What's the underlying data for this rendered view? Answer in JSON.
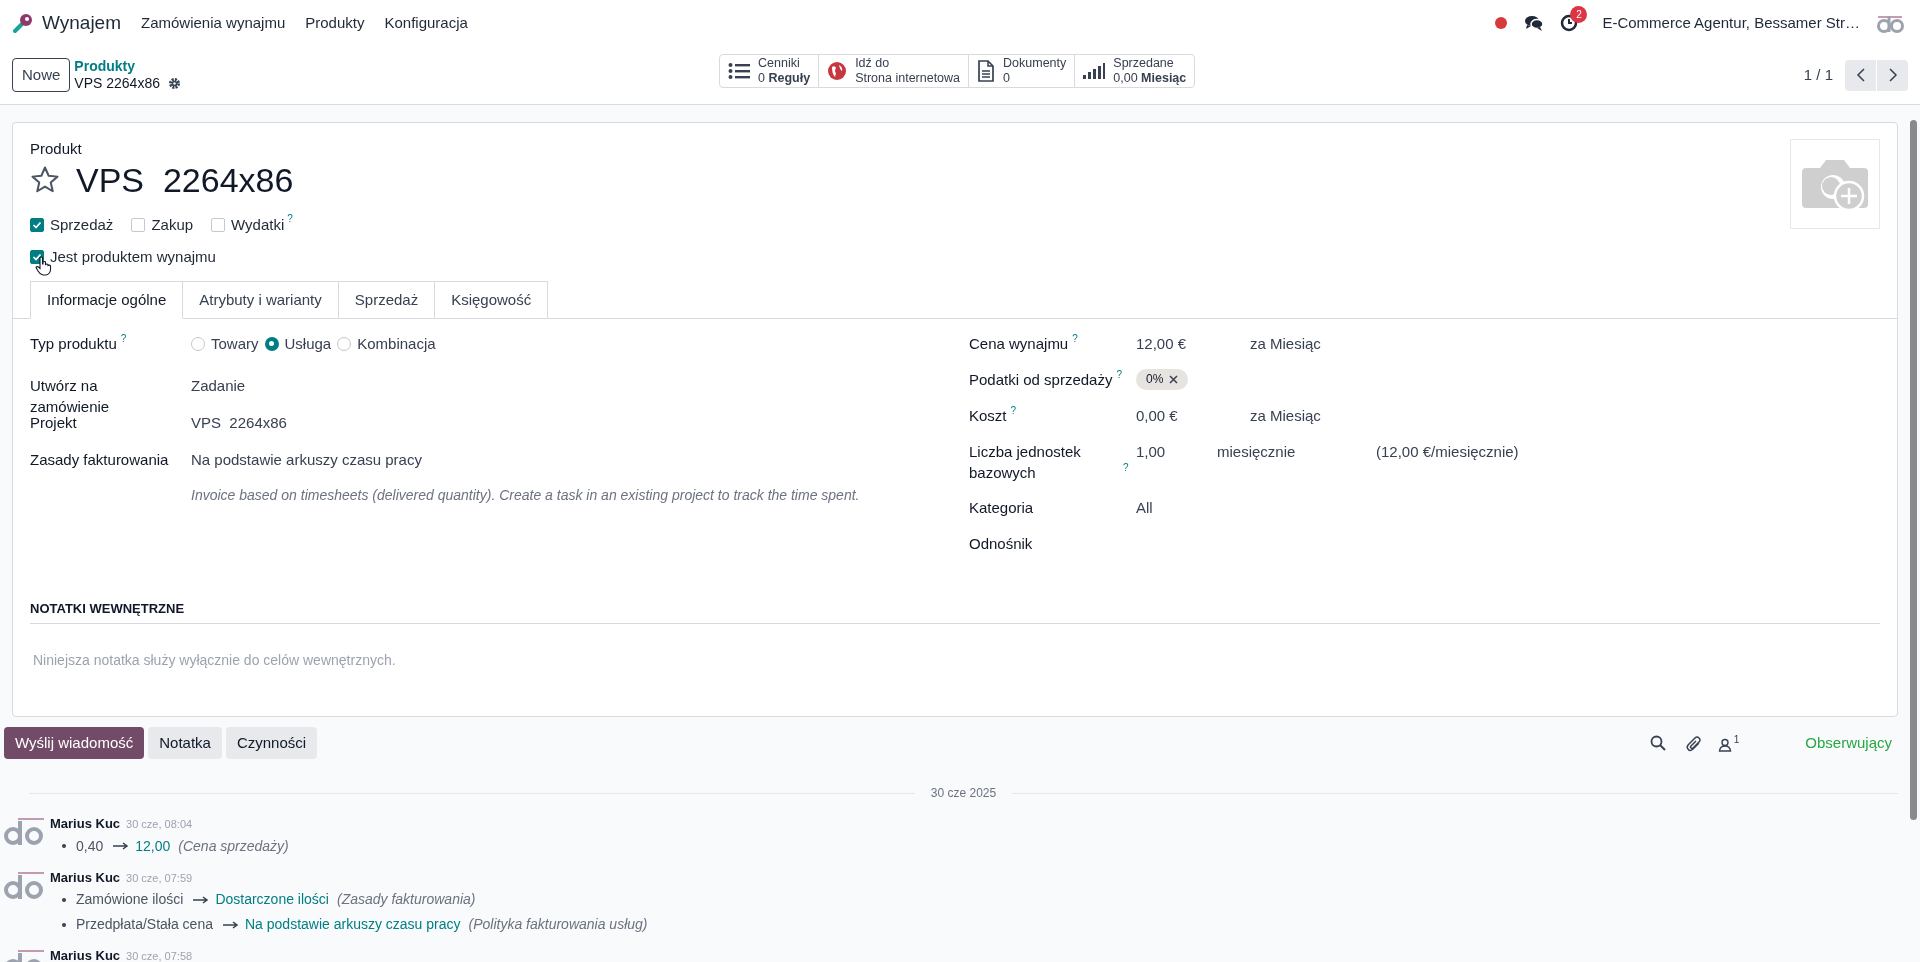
{
  "navbar": {
    "app_name": "Wynajem",
    "menu": [
      "Zamówienia wynajmu",
      "Produkty",
      "Konfiguracja"
    ],
    "activity_badge": "2",
    "company": "E-Commerce Agentur, Bessamer Str…"
  },
  "control_panel": {
    "new_button": "Nowe",
    "breadcrumb": "Produkty",
    "record_name": "VPS 2264x86",
    "smart_buttons": [
      {
        "kind": "list",
        "label": "Cenniki",
        "value": "0",
        "unit": "Reguły"
      },
      {
        "kind": "globe",
        "label": "Idź do",
        "value": "Strona internetowa"
      },
      {
        "kind": "document",
        "label": "Dokumenty",
        "value": "0"
      },
      {
        "kind": "bars",
        "label": "Sprzedane",
        "value": "0,00",
        "unit": "Miesiąc"
      }
    ],
    "pager": "1 / 1"
  },
  "form": {
    "caption": "Produkt",
    "name": "VPS  2264x86",
    "favorite": false,
    "options": [
      {
        "label": "Sprzedaż",
        "checked": true
      },
      {
        "label": "Zakup",
        "checked": false
      },
      {
        "label": "Wydatki",
        "checked": false,
        "help": "?"
      }
    ],
    "rental": {
      "label": "Jest produktem wynajmu",
      "checked": true
    },
    "tabs": [
      {
        "label": "Informacje ogólne",
        "selected": true
      },
      {
        "label": "Atrybuty i warianty",
        "selected": false
      },
      {
        "label": "Sprzedaż",
        "selected": false
      },
      {
        "label": "Księgowość",
        "selected": false
      }
    ],
    "left_fields": [
      {
        "kind": "radio",
        "label": "Typ produktu",
        "help": "?",
        "options": [
          {
            "label": "Towary",
            "selected": false
          },
          {
            "label": "Usługa",
            "selected": true
          },
          {
            "label": "Kombinacja",
            "selected": false
          }
        ]
      },
      {
        "kind": "text",
        "label": "Utwórz na zamówienie",
        "value": "Zadanie"
      },
      {
        "kind": "text",
        "label": "Projekt",
        "value": "VPS  2264x86"
      },
      {
        "kind": "text",
        "label": "Zasady fakturowania",
        "value": "Na podstawie arkuszy czasu pracy",
        "note": "Invoice based on timesheets (delivered quantity). Create a task in an existing project to track the time spent."
      }
    ],
    "right_fields": [
      {
        "kind": "text",
        "label": "Cena wynajmu",
        "help": "?",
        "value": "12,00 €",
        "suffix": "za Miesiąc"
      },
      {
        "kind": "tags",
        "label": "Podatki od sprzedaży",
        "help": "?",
        "tags": [
          "0%"
        ]
      },
      {
        "kind": "text",
        "label": "Koszt",
        "help": "?",
        "value": "0,00 €",
        "suffix": "za Miesiąc"
      },
      {
        "kind": "units",
        "label": "Liczba jednostek bazowych",
        "help": "?",
        "value": "1,00",
        "unit": "miesięcznie",
        "note": "(12,00 €/miesięcznie)"
      },
      {
        "kind": "text",
        "label": "Kategoria",
        "value": "All"
      },
      {
        "kind": "text",
        "label": "Odnośnik"
      }
    ],
    "notes": {
      "title": "NOTATKI WEWNĘTRZNE",
      "placeholder": "Niniejsza notatka służy wyłącznie do celów wewnętrznych."
    }
  },
  "chatter": {
    "buttons": [
      {
        "label": "Wyślij wiadomość",
        "selected": true
      },
      {
        "label": "Notatka",
        "selected": false
      },
      {
        "label": "Czynności",
        "selected": false
      }
    ],
    "followers_count": "1",
    "follow": "Obserwujący",
    "date": "30 cze 2025",
    "messages": [
      {
        "author": "Marius Kuc",
        "time": "30 cze, 08:04",
        "changes": [
          {
            "old": "0,40",
            "new": "12,00",
            "field": "(Cena sprzedaży)"
          }
        ]
      },
      {
        "author": "Marius Kuc",
        "time": "30 cze, 07:59",
        "changes": [
          {
            "old": "Zamówione ilości",
            "new": "Dostarczone ilości",
            "field": "(Zasady fakturowania)"
          },
          {
            "old": "Przedpłata/Stała cena",
            "new": "Na podstawie arkuszy czasu pracy",
            "field": "(Polityka fakturowania usług)"
          }
        ]
      },
      {
        "author": "Marius Kuc",
        "time": "30 cze, 07:58"
      }
    ]
  }
}
